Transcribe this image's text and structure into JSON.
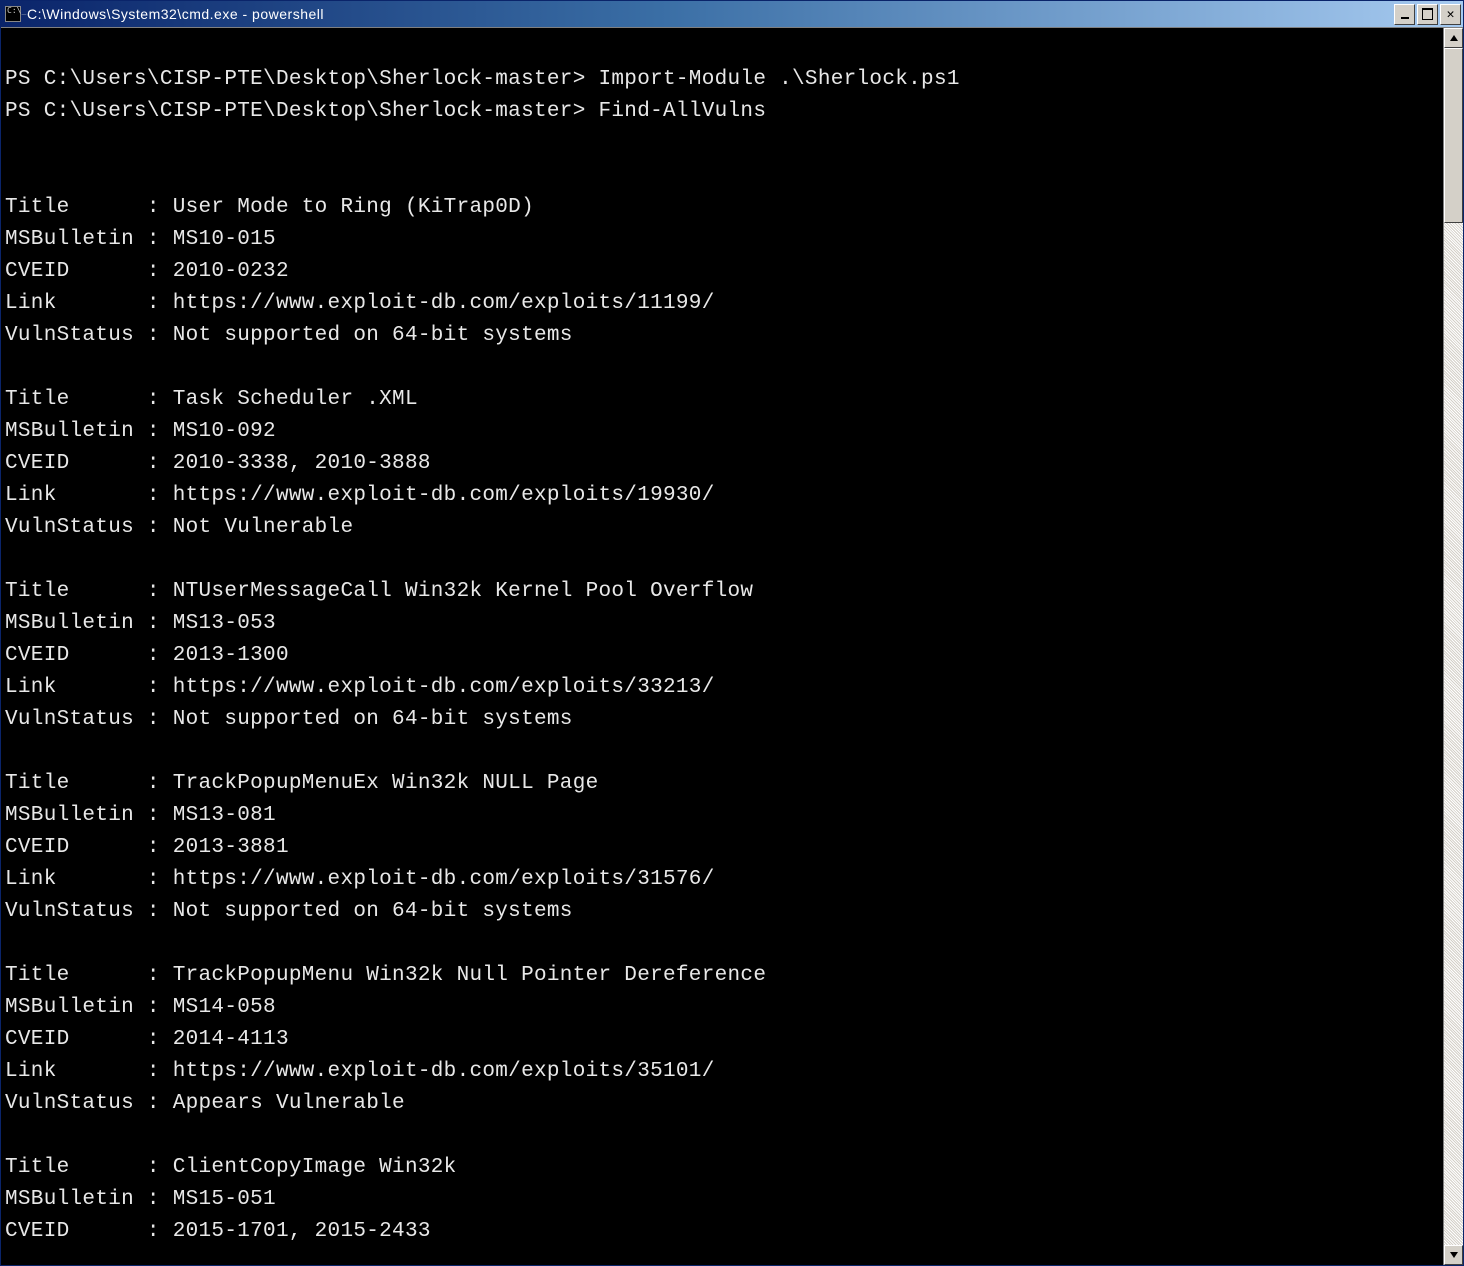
{
  "window": {
    "title": "C:\\Windows\\System32\\cmd.exe - powershell"
  },
  "prompt_lines": [
    {
      "prompt": "PS C:\\Users\\CISP-PTE\\Desktop\\Sherlock-master> ",
      "cmd": "Import-Module .\\Sherlock.ps1"
    },
    {
      "prompt": "PS C:\\Users\\CISP-PTE\\Desktop\\Sherlock-master> ",
      "cmd": "Find-AllVulns"
    }
  ],
  "field_labels": {
    "title": "Title",
    "bulletin": "MSBulletin",
    "cveid": "CVEID",
    "link": "Link",
    "status": "VulnStatus"
  },
  "vulns": [
    {
      "Title": "User Mode to Ring (KiTrap0D)",
      "MSBulletin": "MS10-015",
      "CVEID": "2010-0232",
      "Link": "https://www.exploit-db.com/exploits/11199/",
      "VulnStatus": "Not supported on 64-bit systems"
    },
    {
      "Title": "Task Scheduler .XML",
      "MSBulletin": "MS10-092",
      "CVEID": "2010-3338, 2010-3888",
      "Link": "https://www.exploit-db.com/exploits/19930/",
      "VulnStatus": "Not Vulnerable"
    },
    {
      "Title": "NTUserMessageCall Win32k Kernel Pool Overflow",
      "MSBulletin": "MS13-053",
      "CVEID": "2013-1300",
      "Link": "https://www.exploit-db.com/exploits/33213/",
      "VulnStatus": "Not supported on 64-bit systems"
    },
    {
      "Title": "TrackPopupMenuEx Win32k NULL Page",
      "MSBulletin": "MS13-081",
      "CVEID": "2013-3881",
      "Link": "https://www.exploit-db.com/exploits/31576/",
      "VulnStatus": "Not supported on 64-bit systems"
    },
    {
      "Title": "TrackPopupMenu Win32k Null Pointer Dereference",
      "MSBulletin": "MS14-058",
      "CVEID": "2014-4113",
      "Link": "https://www.exploit-db.com/exploits/35101/",
      "VulnStatus": "Appears Vulnerable"
    },
    {
      "Title": "ClientCopyImage Win32k",
      "MSBulletin": "MS15-051",
      "CVEID": "2015-1701, 2015-2433"
    }
  ]
}
